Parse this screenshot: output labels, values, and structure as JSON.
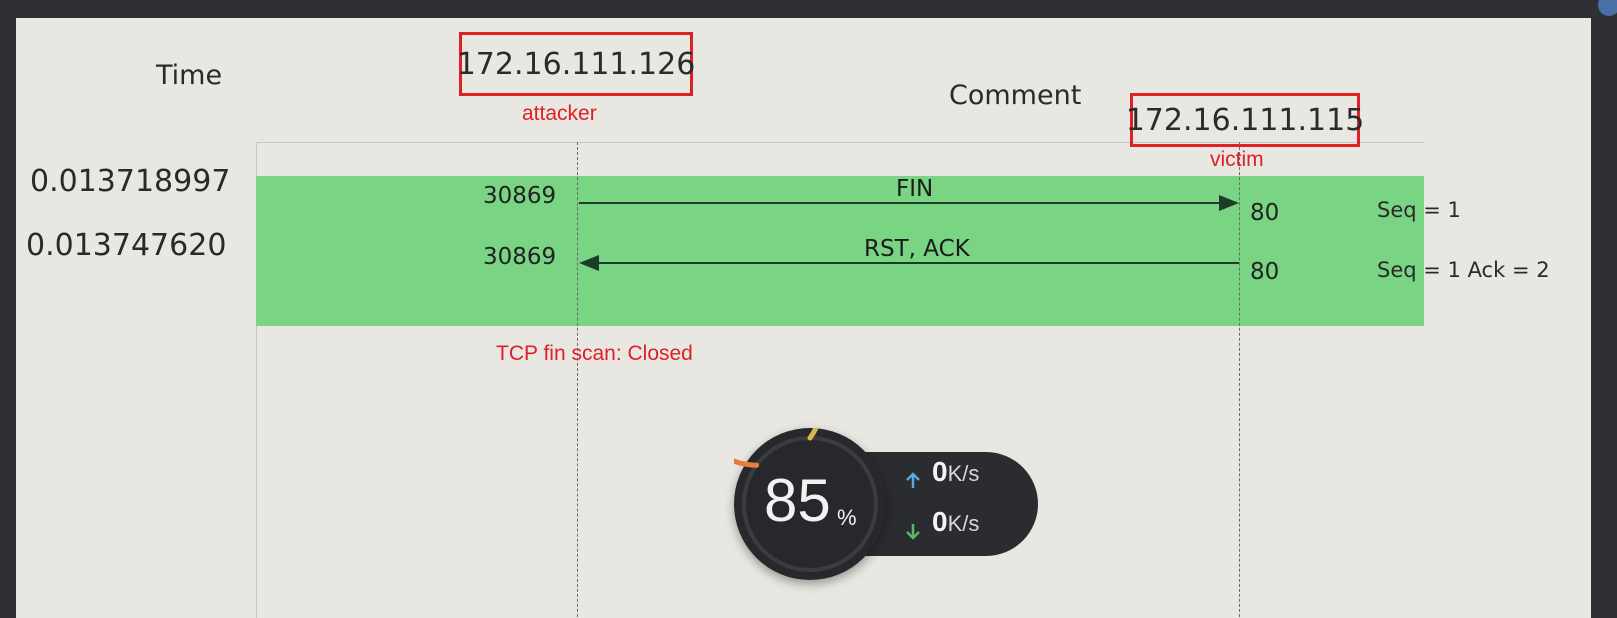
{
  "headers": {
    "time": "Time",
    "comment": "Comment"
  },
  "hosts": {
    "attacker": {
      "ip": "172.16.111.126",
      "role": "attacker"
    },
    "victim": {
      "ip": "172.16.111.115",
      "role": "victim"
    }
  },
  "packets": [
    {
      "time": "0.013718997",
      "src_port": "30869",
      "dst_port": "80",
      "label": "FIN",
      "direction": "attacker-to-victim",
      "comment": "Seq = 1"
    },
    {
      "time": "0.013747620",
      "src_port": "30869",
      "dst_port": "80",
      "label": "RST, ACK",
      "direction": "victim-to-attacker",
      "comment": "Seq = 1 Ack = 2"
    }
  ],
  "annotation": "TCP fin scan: Closed",
  "widget": {
    "percent": "85",
    "percent_symbol": "%",
    "upload_value": "0",
    "download_value": "0",
    "unit": "K/s",
    "upload_icon": "arrow-up-icon",
    "download_icon": "arrow-down-icon"
  },
  "colors": {
    "highlight": "#79d483",
    "annotation_red": "#e01f26",
    "background": "#e8e7e1"
  }
}
